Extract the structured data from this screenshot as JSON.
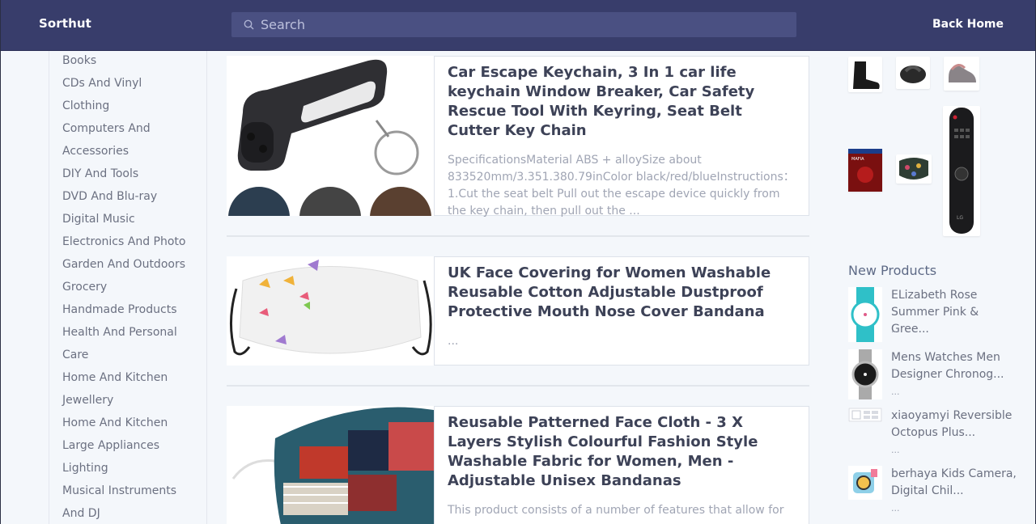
{
  "header": {
    "brand": "Sorthut",
    "search_placeholder": "Search",
    "back_home": "Back Home"
  },
  "sidebar": {
    "categories": [
      "Books",
      "CDs And Vinyl",
      "Clothing",
      "Computers And",
      "Accessories",
      "DIY And Tools",
      "DVD And Blu-ray",
      "Digital Music",
      "Electronics And Photo",
      "Garden And Outdoors",
      "Grocery",
      "Handmade Products",
      "Health And Personal",
      "Care",
      "Home And Kitchen",
      "Jewellery",
      "Home And Kitchen",
      "Large Appliances",
      "Lighting",
      "Musical Instruments",
      "And DJ"
    ]
  },
  "products": [
    {
      "title": "Car Escape Keychain, 3 In 1 car life keychain Window Breaker, Car Safety Rescue Tool With Keyring, Seat Belt Cutter Key Chain",
      "description": "SpecificationsMaterial ABS + alloySize about 833520mm/3.351.380.79inColor black/red/blueInstructions：1.Cut the seat belt Pull out the escape device quickly from the key chain, then pull out the ..."
    },
    {
      "title": "UK Face Covering for Women Washable Reusable Cotton Adjustable Dustproof Protective Mouth Nose Cover Bandana",
      "description": "..."
    },
    {
      "title": "Reusable Patterned Face Cloth - 3 X Layers Stylish Colourful Fashion Style Washable Fabric for Women, Men - Adjustable Unisex Bandanas",
      "description": "This product consists of a number of features that allow for"
    }
  ],
  "new_products": {
    "heading": "New Products",
    "items": [
      {
        "name": "ELizabeth Rose Summer Pink & Gree...",
        "desc": "..."
      },
      {
        "name": "Mens Watches Men Designer Chronog...",
        "desc": "..."
      },
      {
        "name": "xiaoyamyi Reversible Octopus Plus...",
        "desc": "..."
      },
      {
        "name": "berhaya Kids Camera, Digital Chil...",
        "desc": "..."
      }
    ]
  },
  "image_labels": {
    "game_cover": "MAFIA",
    "remote_brand": "LG"
  },
  "colors": {
    "header_bg": "#383d6b",
    "search_bg": "#4a5082",
    "page_bg": "#f4f7fb",
    "title_text": "#3d4257",
    "muted_text": "#a0a5b4"
  }
}
